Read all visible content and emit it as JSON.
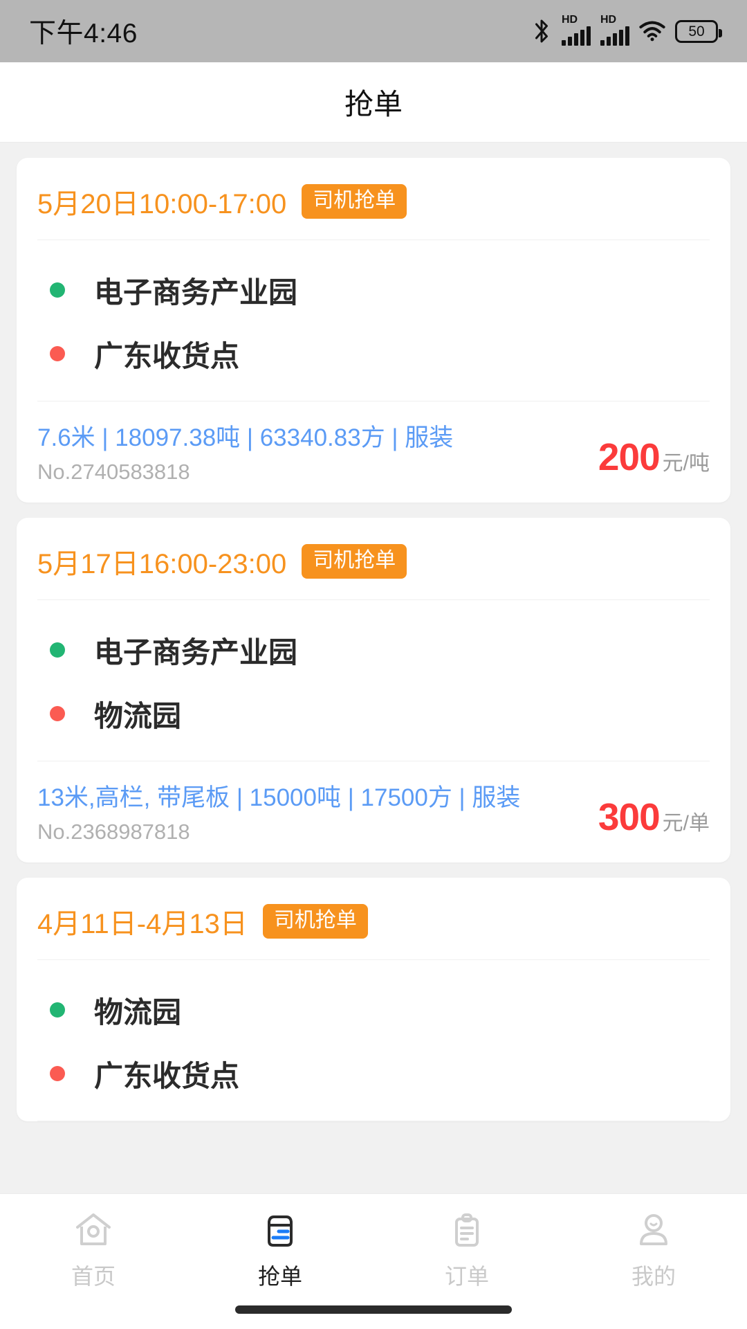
{
  "status_bar": {
    "time": "下午4:46",
    "battery_level": "50",
    "icons": [
      "bluetooth-icon",
      "hd-signal-icon",
      "hd-signal-icon",
      "wifi-icon",
      "battery-icon"
    ]
  },
  "header": {
    "title": "抢单"
  },
  "colors": {
    "accent_orange": "#f7921e",
    "price_red": "#fb3b3b",
    "spec_blue": "#5b9bf5",
    "start_dot_green": "#22b573",
    "end_dot_red": "#fb5b52",
    "page_bg": "#f1f1f1",
    "status_bar_bg": "#b6b6b6"
  },
  "orders": [
    {
      "date": "5月20日10:00-17:00",
      "badge": "司机抢单",
      "start": "电子商务产业园",
      "end": "广东收货点",
      "spec": "7.6米 | 18097.38吨 | 63340.83方 | 服装",
      "order_no": "No.2740583818",
      "price": "200",
      "price_unit": "元/吨"
    },
    {
      "date": "5月17日16:00-23:00",
      "badge": "司机抢单",
      "start": "电子商务产业园",
      "end": "物流园",
      "spec": "13米,高栏, 带尾板 | 15000吨 | 17500方 | 服装",
      "order_no": "No.2368987818",
      "price": "300",
      "price_unit": "元/单"
    },
    {
      "date": "4月11日-4月13日",
      "badge": "司机抢单",
      "start": "物流园",
      "end": "广东收货点",
      "spec": "",
      "order_no": "",
      "price": "",
      "price_unit": ""
    }
  ],
  "tabbar": {
    "items": [
      {
        "label": "首页",
        "icon": "home-icon",
        "active": false
      },
      {
        "label": "抢单",
        "icon": "box-order-icon",
        "active": true
      },
      {
        "label": "订单",
        "icon": "clipboard-icon",
        "active": false
      },
      {
        "label": "我的",
        "icon": "person-icon",
        "active": false
      }
    ]
  }
}
